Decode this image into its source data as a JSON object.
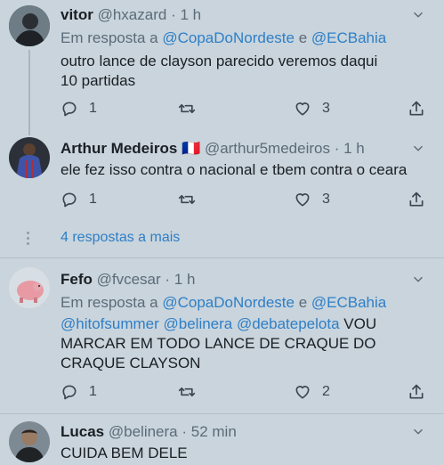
{
  "tweets": [
    {
      "name": "vitor",
      "handle": "@hxazard",
      "time": "· 1 h",
      "reply_prefix": "Em resposta a",
      "reply_user1": "@CopaDoNordeste",
      "reply_and": "e",
      "reply_user2": "@ECBahia",
      "text": "outro lance de clayson parecido veremos daqui 10 partidas",
      "replies": "1",
      "likes": "3"
    },
    {
      "name": "Arthur Medeiros",
      "flag": "🇫🇷",
      "handle": "@arthur5medeiros",
      "time": "· 1 h",
      "text": "ele fez isso contra o nacional e tbem contra o ceara",
      "replies": "1",
      "likes": "3"
    },
    {
      "name": "Fefo",
      "handle": "@fvcesar",
      "time": "· 1 h",
      "reply_prefix": "Em resposta a",
      "reply_user1": "@CopaDoNordeste",
      "reply_and": "e",
      "reply_user2": "@ECBahia",
      "mentions": "@hitofsummer @belinera @debatepelota",
      "text_line1": "VOU",
      "text_line2": "MARCAR EM TODO LANCE DE CRAQUE DO",
      "text_line3": "CRAQUE CLAYSON",
      "replies": "1",
      "likes": "2"
    },
    {
      "name": "Lucas",
      "handle": "@belinera",
      "time": "· 52 min",
      "text": "CUIDA BEM DELE"
    }
  ],
  "more_replies": "4 respostas a mais",
  "colors": {
    "background": "#c9d4dc",
    "link": "#2e7fc7",
    "meta": "#5c6b78"
  },
  "icons": [
    "reply-icon",
    "retweet-icon",
    "like-icon",
    "share-icon",
    "chevron-down-icon"
  ]
}
